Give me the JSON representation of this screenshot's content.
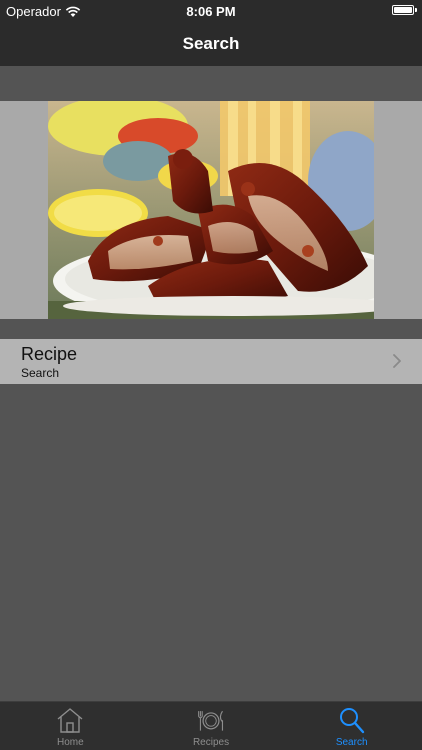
{
  "status_bar": {
    "carrier": "Operador",
    "time": "8:06 PM"
  },
  "nav": {
    "title": "Search"
  },
  "recipe": {
    "title": "Recipe",
    "subtitle": "Search"
  },
  "tabs": [
    {
      "label": "Home",
      "icon": "home-icon",
      "active": false
    },
    {
      "label": "Recipes",
      "icon": "fork-plate-knife-icon",
      "active": false
    },
    {
      "label": "Search",
      "icon": "search-icon",
      "active": true
    }
  ],
  "colors": {
    "accent": "#1e90ff",
    "bars": "#2b2b2b",
    "background": "#545454"
  }
}
